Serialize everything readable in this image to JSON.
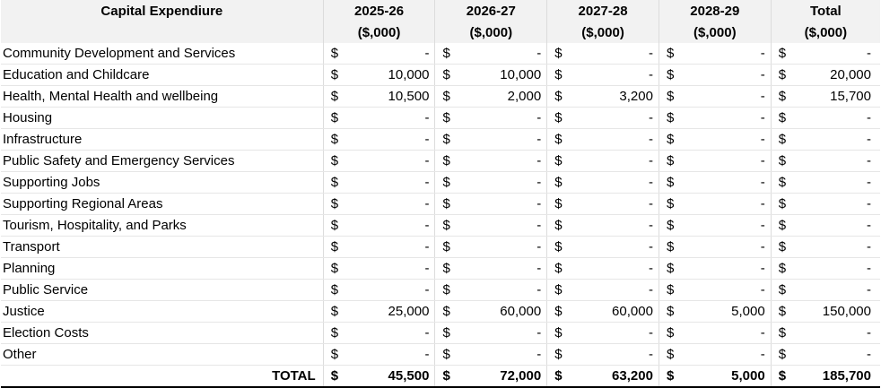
{
  "header": {
    "title": "Capital Expendiure",
    "columns": [
      {
        "year": "2025-26",
        "unit": "($,000)"
      },
      {
        "year": "2026-27",
        "unit": "($,000)"
      },
      {
        "year": "2027-28",
        "unit": "($,000)"
      },
      {
        "year": "2028-29",
        "unit": "($,000)"
      },
      {
        "year": "Total",
        "unit": "($,000)"
      }
    ]
  },
  "currency_symbol": "$",
  "rows": [
    {
      "label": "Community Development and Services",
      "values": [
        "-",
        "-",
        "-",
        "-",
        "-"
      ]
    },
    {
      "label": "Education and Childcare",
      "values": [
        "10,000",
        "10,000",
        "-",
        "-",
        "20,000"
      ]
    },
    {
      "label": "Health, Mental Health and wellbeing",
      "values": [
        "10,500",
        "2,000",
        "3,200",
        "-",
        "15,700"
      ]
    },
    {
      "label": "Housing",
      "values": [
        "-",
        "-",
        "-",
        "-",
        "-"
      ]
    },
    {
      "label": "Infrastructure",
      "values": [
        "-",
        "-",
        "-",
        "-",
        "-"
      ]
    },
    {
      "label": "Public Safety and Emergency Services",
      "values": [
        "-",
        "-",
        "-",
        "-",
        "-"
      ]
    },
    {
      "label": "Supporting Jobs",
      "values": [
        "-",
        "-",
        "-",
        "-",
        "-"
      ]
    },
    {
      "label": "Supporting Regional Areas",
      "values": [
        "-",
        "-",
        "-",
        "-",
        "-"
      ]
    },
    {
      "label": "Tourism, Hospitality, and Parks",
      "values": [
        "-",
        "-",
        "-",
        "-",
        "-"
      ]
    },
    {
      "label": "Transport",
      "values": [
        "-",
        "-",
        "-",
        "-",
        "-"
      ]
    },
    {
      "label": "Planning",
      "values": [
        "-",
        "-",
        "-",
        "-",
        "-"
      ]
    },
    {
      "label": "Public Service",
      "values": [
        "-",
        "-",
        "-",
        "-",
        "-"
      ]
    },
    {
      "label": "Justice",
      "values": [
        "25,000",
        "60,000",
        "60,000",
        "5,000",
        "150,000"
      ]
    },
    {
      "label": "Election Costs",
      "values": [
        "-",
        "-",
        "-",
        "-",
        "-"
      ]
    },
    {
      "label": "Other",
      "values": [
        "-",
        "-",
        "-",
        "-",
        "-"
      ]
    }
  ],
  "total": {
    "label": "TOTAL",
    "values": [
      "45,500",
      "72,000",
      "63,200",
      "5,000",
      "185,700"
    ]
  }
}
